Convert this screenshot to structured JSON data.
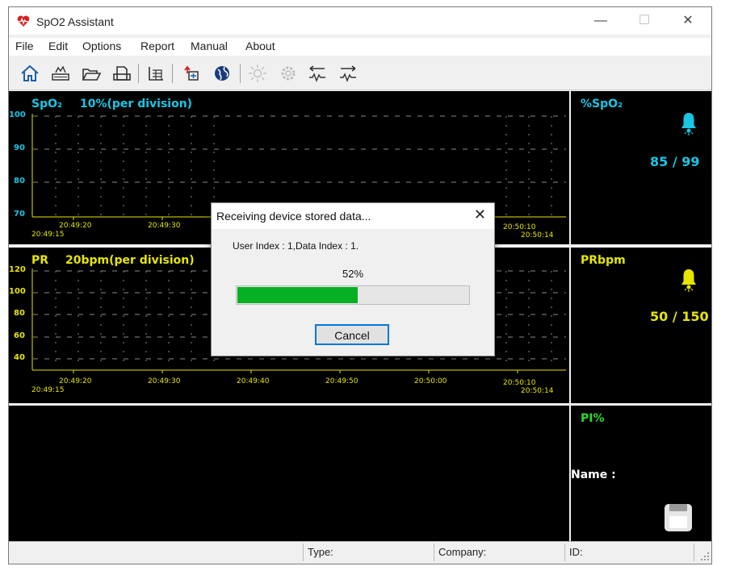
{
  "window": {
    "title": "SpO2 Assistant",
    "minimize": "—",
    "maximize": "☐",
    "close": "✕"
  },
  "menu": [
    "File",
    "Edit",
    "Options",
    "Report",
    "Manual",
    "About"
  ],
  "toolbar": [
    "home-icon",
    "device-icon",
    "open-folder-icon",
    "print-icon",
    "table-icon",
    "upload-icon",
    "globe-icon",
    "sun-icon",
    "gear-icon",
    "left-waveform-icon",
    "right-waveform-icon"
  ],
  "spo2_chart": {
    "label": "SpO₂",
    "scale": "10%(per division)",
    "yticks": [
      "100",
      "90",
      "80",
      "70"
    ],
    "xticks_top": [
      "20:49:20",
      "20:49:30",
      "20:50:10"
    ],
    "xticks_bottom": [
      "20:49:15",
      "20:50:14"
    ]
  },
  "pr_chart": {
    "label": "PR",
    "scale": "20bpm(per division)",
    "yticks": [
      "120",
      "100",
      "80",
      "60",
      "40"
    ],
    "xticks_top": [
      "20:49:20",
      "20:49:30",
      "20:49:40",
      "20:49:50",
      "20:50:00",
      "20:50:10"
    ],
    "xticks_bottom": [
      "20:49:15",
      "20:50:14"
    ]
  },
  "spo2_stat": {
    "name": "%SpO₂",
    "value": "85 / 99"
  },
  "pr_stat": {
    "name": "PRbpm",
    "value": "50 / 150"
  },
  "pi_stat": {
    "name": "PI%"
  },
  "name_label": "Name :",
  "status": {
    "type": "Type:",
    "company": "Company:",
    "id": "ID:"
  },
  "dialog": {
    "title": "Receiving device stored data...",
    "close": "✕",
    "info": "User Index : 1,Data Index : 1.",
    "percent_text": "52%",
    "progress": 0.52,
    "cancel": "Cancel"
  },
  "colors": {
    "cyan": "#19c6e6",
    "yellow": "#e6e600",
    "green": "#2bdc2b",
    "progress": "#06b025"
  }
}
